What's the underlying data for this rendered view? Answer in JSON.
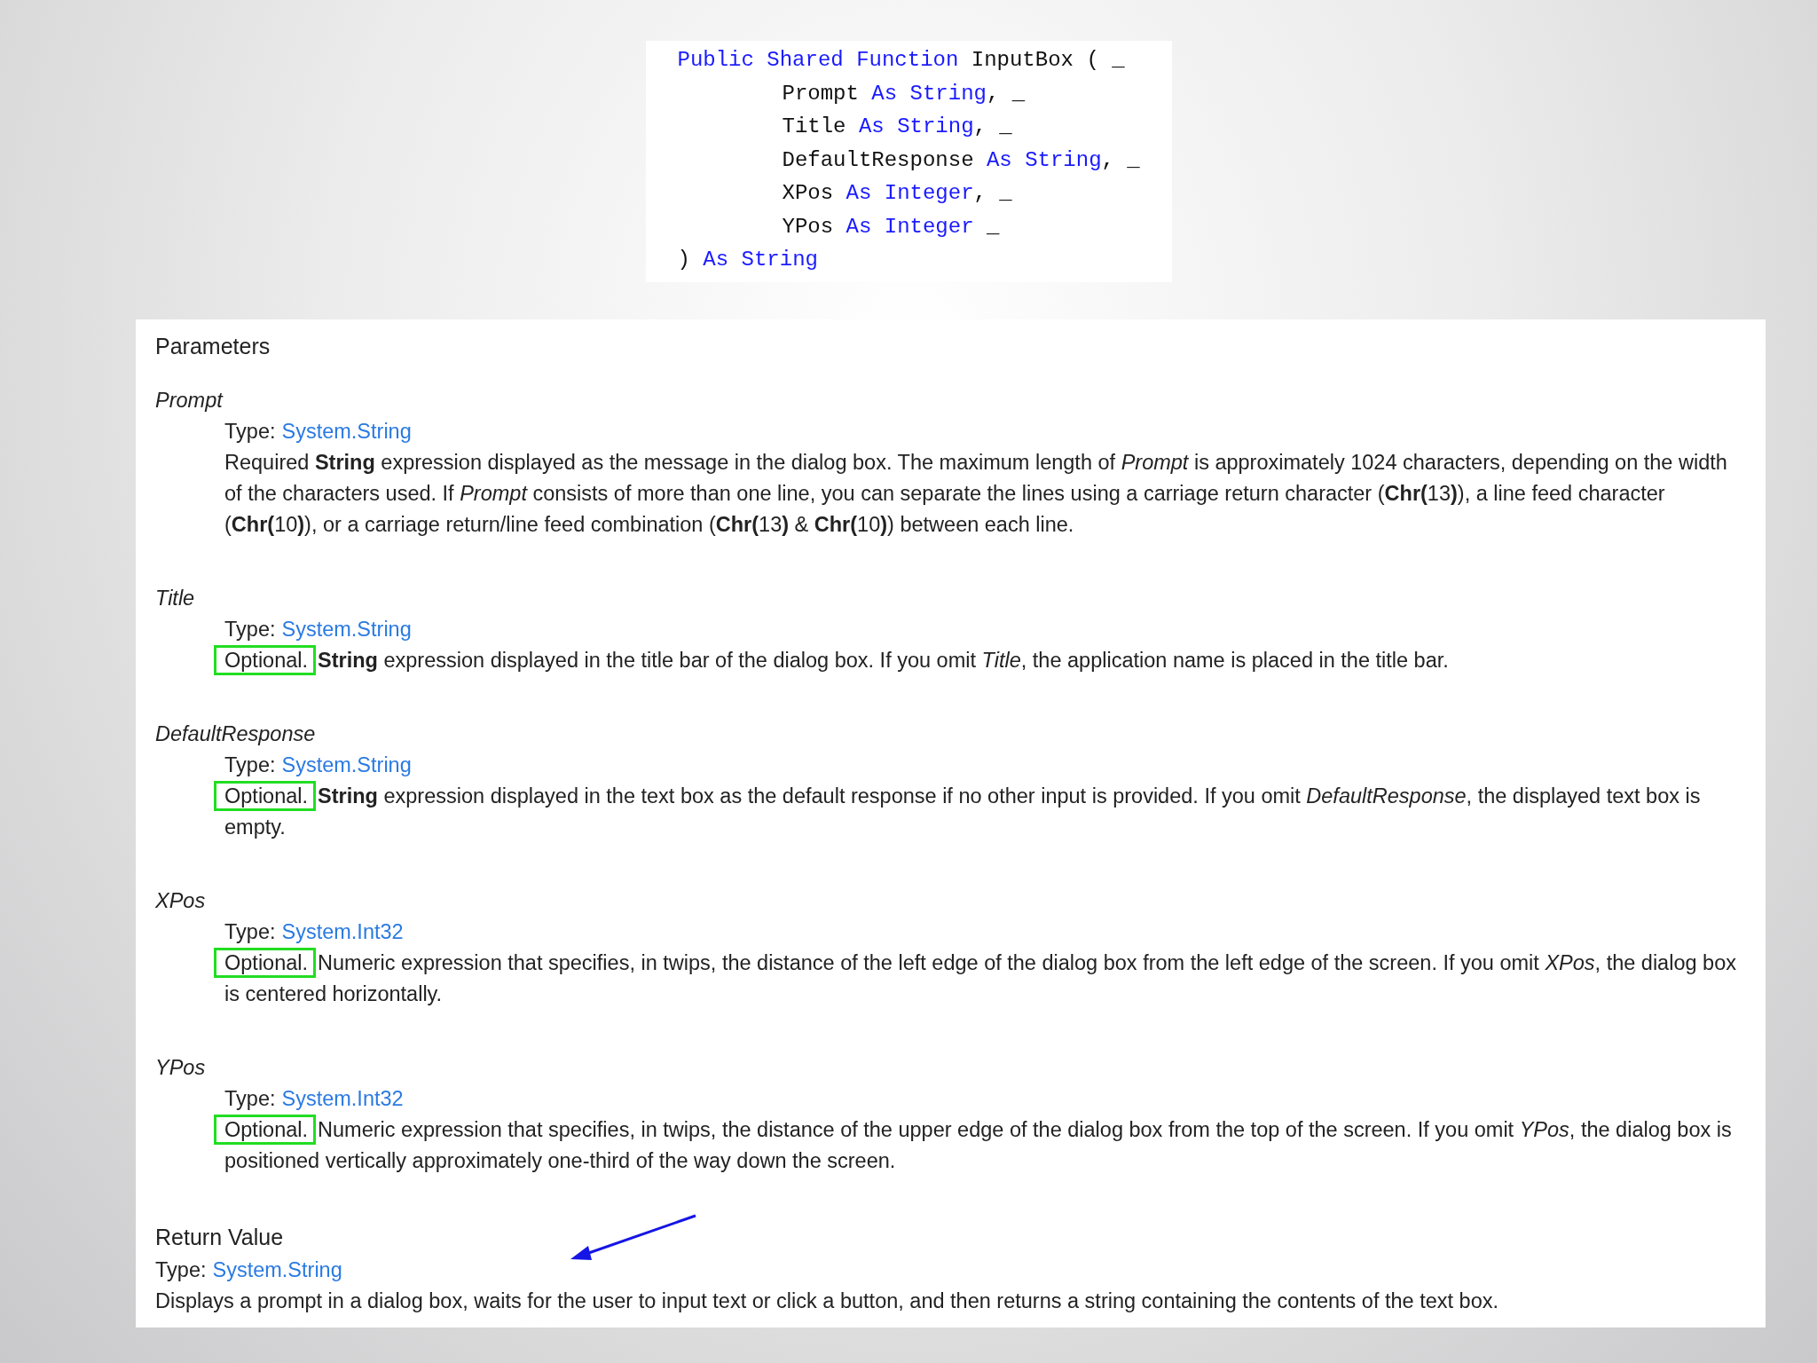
{
  "code": {
    "lines": [
      {
        "indented": false,
        "tokens": [
          {
            "kind": "keyword",
            "text": "Public Shared Function"
          },
          {
            "kind": "plain",
            "text": " InputBox ( _"
          }
        ]
      },
      {
        "indented": true,
        "tokens": [
          {
            "kind": "plain",
            "text": "Prompt "
          },
          {
            "kind": "keyword",
            "text": "As String"
          },
          {
            "kind": "plain",
            "text": ", _"
          }
        ]
      },
      {
        "indented": true,
        "tokens": [
          {
            "kind": "plain",
            "text": "Title "
          },
          {
            "kind": "keyword",
            "text": "As String"
          },
          {
            "kind": "plain",
            "text": ", _"
          }
        ]
      },
      {
        "indented": true,
        "tokens": [
          {
            "kind": "plain",
            "text": "DefaultResponse "
          },
          {
            "kind": "keyword",
            "text": "As String"
          },
          {
            "kind": "plain",
            "text": ", _"
          }
        ]
      },
      {
        "indented": true,
        "tokens": [
          {
            "kind": "plain",
            "text": "XPos "
          },
          {
            "kind": "keyword",
            "text": "As Integer"
          },
          {
            "kind": "plain",
            "text": ", _"
          }
        ]
      },
      {
        "indented": true,
        "tokens": [
          {
            "kind": "plain",
            "text": "YPos "
          },
          {
            "kind": "keyword",
            "text": "As Integer"
          },
          {
            "kind": "plain",
            "text": " _"
          }
        ]
      },
      {
        "indented": false,
        "tokens": [
          {
            "kind": "plain",
            "text": ") "
          },
          {
            "kind": "keyword",
            "text": "As String"
          }
        ]
      }
    ]
  },
  "parameters": {
    "heading": "Parameters",
    "items": [
      {
        "name": "Prompt",
        "type_label": "Type:",
        "type_link": "System.String",
        "description": "Required **String** expression displayed as the message in the dialog box. The maximum length of *Prompt* is approximately 1024 characters, depending on the width of the characters used. If *Prompt* consists of more than one line, you can separate the lines using a carriage return character (**Chr(**13**)**), a line feed character (**Chr(**10**)**), or a carriage return/line feed combination (**Chr(**13**)** & **Chr(**10**)**) between each line."
      },
      {
        "name": "Title",
        "type_label": "Type:",
        "type_link": "System.String",
        "badge": {
          "text": "Optional.",
          "highlighted": true
        },
        "description": "**String** expression displayed in the title bar of the dialog box. If you omit *Title*, the application name is placed in the title bar."
      },
      {
        "name": "DefaultResponse",
        "type_label": "Type:",
        "type_link": "System.String",
        "badge": {
          "text": "Optional.",
          "highlighted": true
        },
        "description": "**String** expression displayed in the text box as the default response if no other input is provided. If you omit *DefaultResponse*, the displayed text box is empty."
      },
      {
        "name": "XPos",
        "type_label": "Type:",
        "type_link": "System.Int32",
        "badge": {
          "text": "Optional.",
          "highlighted": true
        },
        "description": "Numeric expression that specifies, in twips, the distance of the left edge of the dialog box from the left edge of the screen. If you omit *XPos*, the dialog box is centered horizontally."
      },
      {
        "name": "YPos",
        "type_label": "Type:",
        "type_link": "System.Int32",
        "badge": {
          "text": "Optional.",
          "highlighted": true
        },
        "description": "Numeric expression that specifies, in twips, the distance of the upper edge of the dialog box from the top of the screen. If you omit *YPos*, the dialog box is positioned vertically approximately one-third of the way down the screen."
      }
    ]
  },
  "return_value": {
    "heading": "Return Value",
    "type_label": "Type:",
    "type_link": "System.String",
    "description": "Displays a prompt in a dialog box, waits for the user to input text or click a button, and then returns a string containing the contents of the text box."
  }
}
